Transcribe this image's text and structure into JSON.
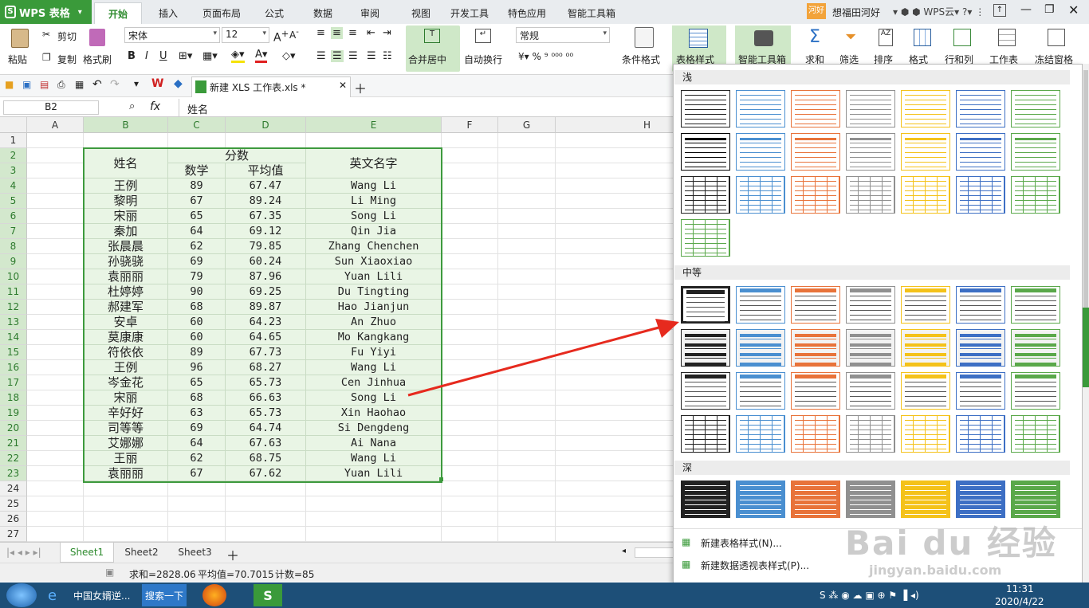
{
  "app": {
    "name": "WPS 表格"
  },
  "menu_tabs": [
    "开始",
    "插入",
    "页面布局",
    "公式",
    "数据",
    "审阅",
    "视图",
    "开发工具",
    "特色应用",
    "智能工具箱"
  ],
  "user": {
    "badge": "河好",
    "name": "想福田河好",
    "cloud_label": "WPS云",
    "help": "?"
  },
  "ribbon": {
    "paste": "粘贴",
    "cut": "剪切",
    "copy": "复制",
    "format_painter": "格式刷",
    "font": "宋体",
    "font_size": "12",
    "merge_center": "合并居中",
    "wrap": "自动换行",
    "number_format": "常规",
    "cond_format": "条件格式",
    "table_style": "表格样式",
    "smart_toolbox": "智能工具箱",
    "sum": "求和",
    "filter": "筛选",
    "sort": "排序",
    "format": "格式",
    "row_col": "行和列",
    "worksheet": "工作表",
    "freeze": "冻结窗格"
  },
  "doc_tab": {
    "title": "新建 XLS 工作表.xls *"
  },
  "formula_bar": {
    "cell_ref": "B2",
    "fx": "fx",
    "content": "姓名"
  },
  "columns": [
    "A",
    "B",
    "C",
    "D",
    "E",
    "F",
    "G",
    "H"
  ],
  "rows": [
    "1",
    "2",
    "3",
    "4",
    "5",
    "6",
    "7",
    "8",
    "9",
    "10",
    "11",
    "12",
    "13",
    "14",
    "15",
    "16",
    "17",
    "18",
    "19",
    "20",
    "21",
    "22",
    "23",
    "24",
    "25",
    "26",
    "27"
  ],
  "table": {
    "header_name": "姓名",
    "header_score": "分数",
    "header_math": "数学",
    "header_avg": "平均值",
    "header_en": "英文名字",
    "data": [
      [
        "王例",
        "89",
        "67.47",
        "Wang Li"
      ],
      [
        "黎明",
        "67",
        "89.24",
        "Li Ming"
      ],
      [
        "宋丽",
        "65",
        "67.35",
        "Song Li"
      ],
      [
        "秦加",
        "64",
        "69.12",
        "Qin Jia"
      ],
      [
        "张晨晨",
        "62",
        "79.85",
        "Zhang Chenchen"
      ],
      [
        "孙骁骁",
        "69",
        "60.24",
        "Sun Xiaoxiao"
      ],
      [
        "袁丽丽",
        "79",
        "87.96",
        "Yuan Lili"
      ],
      [
        "杜婷婷",
        "90",
        "69.25",
        "Du Tingting"
      ],
      [
        "郝建军",
        "68",
        "89.87",
        "Hao Jianjun"
      ],
      [
        "安卓",
        "60",
        "64.23",
        "An Zhuo"
      ],
      [
        "莫康康",
        "60",
        "64.65",
        "Mo Kangkang"
      ],
      [
        "符依依",
        "89",
        "67.73",
        "Fu Yiyi"
      ],
      [
        "王例",
        "96",
        "68.27",
        "Wang Li"
      ],
      [
        "岑金花",
        "65",
        "65.73",
        "Cen Jinhua"
      ],
      [
        "宋丽",
        "68",
        "66.63",
        "Song Li"
      ],
      [
        "辛好好",
        "63",
        "65.73",
        "Xin Haohao"
      ],
      [
        "司等等",
        "69",
        "64.74",
        "Si Dengdeng"
      ],
      [
        "艾娜娜",
        "64",
        "67.63",
        "Ai Nana"
      ],
      [
        "王丽",
        "62",
        "68.75",
        "Wang Li"
      ],
      [
        "袁丽丽",
        "67",
        "67.62",
        "Yuan Lili"
      ]
    ]
  },
  "sheets": [
    "Sheet1",
    "Sheet2",
    "Sheet3"
  ],
  "status": {
    "sum": "求和=2828.06",
    "avg": "平均值=70.7015",
    "count": "计数=85"
  },
  "style_panel": {
    "light": "浅",
    "medium": "中等",
    "dark": "深",
    "new_table_style": "新建表格样式(N)...",
    "new_pivot_style": "新建数据透视表样式(P)...",
    "colors": [
      "#222222",
      "#4a8fd0",
      "#e8733a",
      "#909090",
      "#f4c21a",
      "#3d6fc4",
      "#5aa84a"
    ]
  },
  "taskbar": {
    "item1": "中国女婿逆...",
    "search": "搜索一下",
    "time": "11:31",
    "date": "2020/4/22"
  },
  "watermark": {
    "logo": "Bai du 经验",
    "url": "jingyan.baidu.com"
  }
}
